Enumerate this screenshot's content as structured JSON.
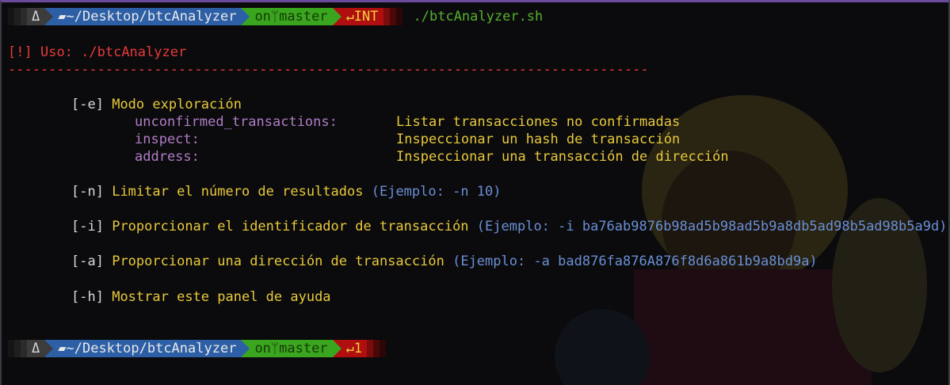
{
  "prompt1": {
    "os_icon": "Δ",
    "dir_icon": "▰",
    "path": "~/Desktop/btcAnalyzer",
    "git_on": "on",
    "git_icon": "ᛘ",
    "branch": "master",
    "status_icon": "↵",
    "status": "INT",
    "command": "./btcAnalyzer.sh"
  },
  "usage": {
    "tag": "[!]",
    "text": "Uso: ./btcAnalyzer",
    "divider": "-------------------------------------------------------------------------------"
  },
  "options": {
    "e": {
      "flag": "[-e]",
      "desc": "Modo exploración"
    },
    "modes": [
      {
        "name": "unconfirmed_transactions:",
        "desc": "Listar transacciones no confirmadas"
      },
      {
        "name": "inspect:",
        "desc": "Inspeccionar un hash de transacción"
      },
      {
        "name": "address:",
        "desc": "Inspeccionar una transacción de dirección"
      }
    ],
    "n": {
      "flag": "[-n]",
      "desc": "Limitar el número de resultados",
      "example": "(Ejemplo: -n 10)"
    },
    "i": {
      "flag": "[-i]",
      "desc": "Proporcionar el identificador de transacción",
      "example": "(Ejemplo: -i ba76ab9876b98ad5b98ad5b9a8db5ad98b5ad98b5a9d)"
    },
    "a": {
      "flag": "[-a]",
      "desc": "Proporcionar una dirección de transacción",
      "example": "(Ejemplo: -a bad876fa876A876f8d6a861b9a8bd9a)"
    },
    "h": {
      "flag": "[-h]",
      "desc": "Mostrar este panel de ayuda"
    }
  },
  "prompt2": {
    "os_icon": "Δ",
    "dir_icon": "▰",
    "path": "~/Desktop/btcAnalyzer",
    "git_on": "on",
    "git_icon": "ᛘ",
    "branch": "master",
    "status_icon": "↵",
    "status": "1"
  }
}
